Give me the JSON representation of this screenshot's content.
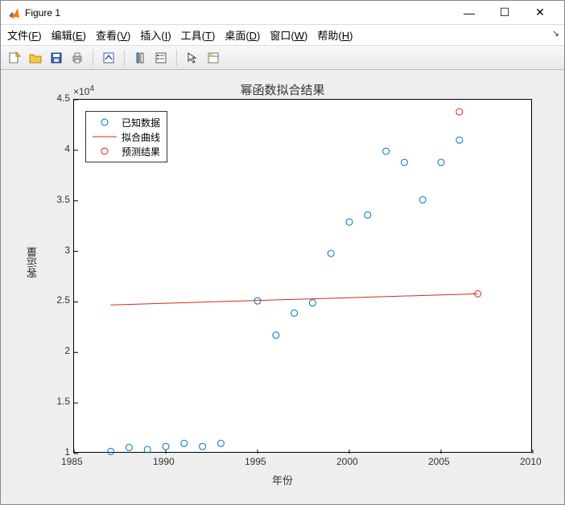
{
  "window": {
    "title": "Figure 1",
    "min_icon": "—",
    "max_icon": "☐",
    "close_icon": "✕"
  },
  "menu": {
    "file": {
      "pre": "文件(",
      "ul": "F",
      "post": ")"
    },
    "edit": {
      "pre": "编辑(",
      "ul": "E",
      "post": ")"
    },
    "view": {
      "pre": "查看(",
      "ul": "V",
      "post": ")"
    },
    "insert": {
      "pre": "插入(",
      "ul": "I",
      "post": ")"
    },
    "tools": {
      "pre": "工具(",
      "ul": "T",
      "post": ")"
    },
    "desktop": {
      "pre": "桌面(",
      "ul": "D",
      "post": ")"
    },
    "window_m": {
      "pre": "窗口(",
      "ul": "W",
      "post": ")"
    },
    "help": {
      "pre": "帮助(",
      "ul": "H",
      "post": ")"
    }
  },
  "toolbar_icons": {
    "new": "new-figure-icon",
    "open": "open-file-icon",
    "save": "save-icon",
    "print": "print-icon",
    "link": "link-data-icon",
    "colorbar": "colorbar-icon",
    "legend": "legend-icon",
    "arrow": "edit-plot-icon",
    "props": "property-inspector-icon"
  },
  "chart_data": {
    "type": "scatter",
    "title": "幂函数拟合结果",
    "xlabel": "年份",
    "ylabel": "客运量",
    "y_exponent": "×10",
    "y_exponent_sup": "4",
    "xlim": [
      1985,
      2010
    ],
    "ylim": [
      1.0,
      4.5
    ],
    "xticks": [
      1985,
      1990,
      1995,
      2000,
      2005,
      2010
    ],
    "yticks": [
      1,
      1.5,
      2,
      2.5,
      3,
      3.5,
      4,
      4.5
    ],
    "series": [
      {
        "name": "已知数据",
        "type": "scatter_open_circle",
        "color": "#0072BD",
        "x": [
          1987,
          1988,
          1989,
          1990,
          1991,
          1992,
          1993,
          1995,
          1996,
          1997,
          1998,
          1999,
          2000,
          2001,
          2002,
          2003,
          2004,
          2005,
          2006
        ],
        "y": [
          1.02,
          1.06,
          1.04,
          1.07,
          1.1,
          1.07,
          1.1,
          2.51,
          2.17,
          2.39,
          2.49,
          2.98,
          3.29,
          3.36,
          3.99,
          3.88,
          3.51,
          3.88,
          4.1
        ]
      },
      {
        "name": "拟合曲线",
        "type": "line",
        "color": "#D9261C",
        "x": [
          1987,
          2007
        ],
        "y": [
          2.47,
          2.58
        ]
      },
      {
        "name": "预测结果",
        "type": "scatter_open_circle",
        "color": "#D9261C",
        "x": [
          2006,
          2007
        ],
        "y": [
          4.38,
          2.58
        ]
      }
    ],
    "legend": {
      "items": [
        "已知数据",
        "拟合曲线",
        "预测结果"
      ]
    }
  }
}
